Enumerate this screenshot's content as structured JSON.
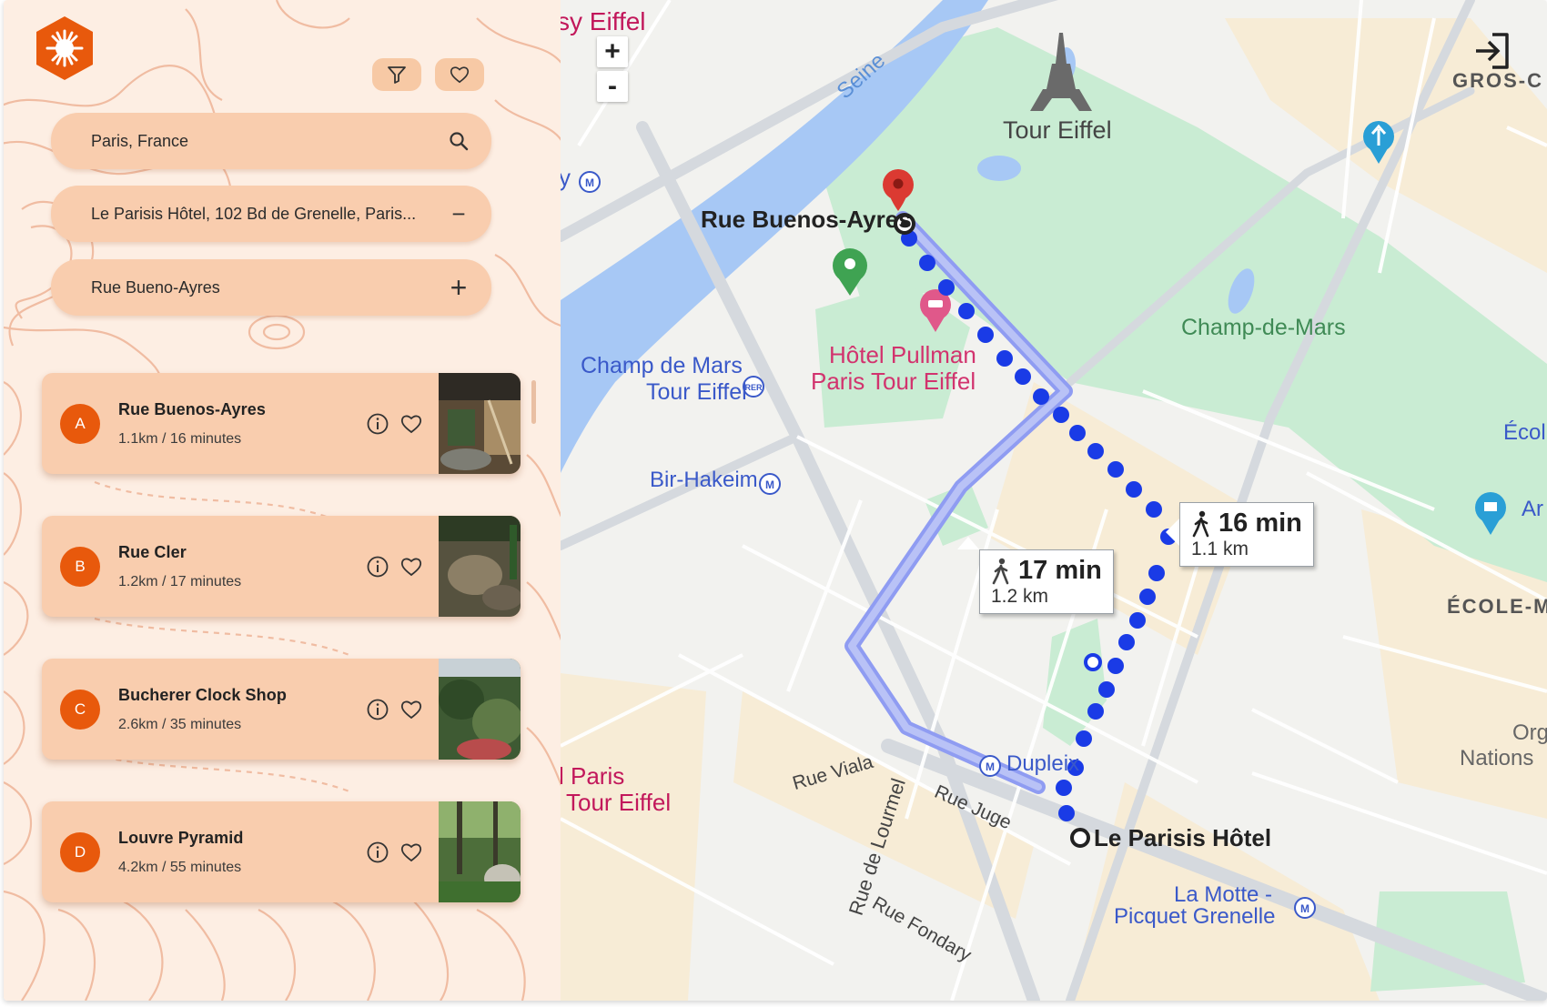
{
  "sidebar": {
    "filter_icon": "filter-icon",
    "favorites_icon": "heart-icon",
    "search": {
      "value": "Paris, France",
      "icon": "search-icon"
    },
    "origin": {
      "value": "Le Parisis Hôtel, 102 Bd de Grenelle, Paris...",
      "action": "−"
    },
    "stop": {
      "value": "Rue Bueno-Ayres",
      "action": "+"
    },
    "places": [
      {
        "letter": "A",
        "name": "Rue Buenos-Ayres",
        "distance": "1.1km / 16 minutes"
      },
      {
        "letter": "B",
        "name": "Rue Cler",
        "distance": "1.2km / 17 minutes"
      },
      {
        "letter": "C",
        "name": "Bucherer Clock Shop",
        "distance": "2.6km / 35 minutes"
      },
      {
        "letter": "D",
        "name": "Louvre Pyramid",
        "distance": "4.2km / 55 minutes"
      }
    ],
    "accent": "#e8590c"
  },
  "map": {
    "zoom_in": "+",
    "zoom_out": "-",
    "exit_icon": "sign-in-icon",
    "route_main": {
      "time": "16 min",
      "distance": "1.1 km"
    },
    "route_alt": {
      "time": "17 min",
      "distance": "1.2 km"
    },
    "labels": {
      "eiffel_top": "sy Eiffel",
      "seine": "Seine",
      "tour_eiffel": "Tour Eiffel",
      "gros": "GROS-C",
      "buenos": "Rue Buenos-Ayres",
      "champ_mars_park": "Champ-de-Mars",
      "hotel_l1": "Hôtel Pullman",
      "hotel_l2": "Paris Tour Eiffel",
      "station_l1": "Champ de Mars",
      "station_l2": "Tour Eiffel",
      "ecol": "Écol",
      "bir": "Bir-Hakeim",
      "ar": "Ar",
      "ecole_m": "ÉCOLE-M",
      "org_l1": "Org",
      "org_l2": "Nations",
      "paris_l1": "l Paris",
      "paris_l2": "Tour Eiffel",
      "dupleix": "Dupleix",
      "viala": "Rue Viala",
      "juge": "Rue Juge",
      "lourmel": "Rue de Lourmel",
      "parisis": "Le Parisis Hôtel",
      "fondary": "Rue Fondary",
      "motte_l1": "La Motte -",
      "motte_l2": "Picquet Grenelle",
      "y": "y"
    },
    "colors": {
      "route": "#1a3be6",
      "alt_route": "#8f9cf2",
      "park": "#c9ecd3",
      "water": "#a7c8f5"
    }
  }
}
